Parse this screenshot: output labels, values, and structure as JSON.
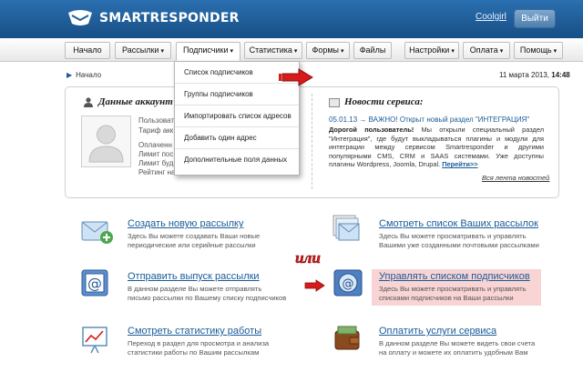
{
  "header": {
    "logo_text": "SMARTRESPONDER",
    "user": "Coolgirl",
    "logout_label": "Выйти",
    "colors": {
      "header_bg": "#1d5e9c",
      "link": "#1a5b97",
      "highlight": "#f9d4d4",
      "arrow": "#d61b1b"
    }
  },
  "nav": {
    "items": [
      {
        "label": "Начало"
      },
      {
        "label": "Рассылки"
      },
      {
        "label": "Подписчики"
      },
      {
        "label": "Статистика"
      },
      {
        "label": "Формы"
      },
      {
        "label": "Файлы"
      },
      {
        "label": "Настройки"
      },
      {
        "label": "Оплата"
      },
      {
        "label": "Помощь"
      }
    ],
    "caret": "▾"
  },
  "dropdown": {
    "items": [
      {
        "label": "Список подписчиков"
      },
      {
        "label": "Группы подписчиков"
      },
      {
        "label": "Импортировать список адресов"
      },
      {
        "label": "Добавить один адрес"
      },
      {
        "label": "Дополнительные поля данных"
      }
    ]
  },
  "breadcrumb": {
    "arrow": "▶",
    "label": "Начало"
  },
  "datetime": {
    "date": "11 марта 2013,",
    "time": "14:48"
  },
  "account": {
    "title": "Данные аккаунт",
    "lines": [
      "Пользоват",
      "Тариф акк",
      "Оплаченн",
      "Лимит пос",
      "Лимит буд",
      "Рейтинг на"
    ]
  },
  "news": {
    "title": "Новости сервиса:",
    "date": "05.01.13",
    "arrow": "→",
    "headline": "ВАЖНО! Открыт новый раздел \"ИНТЕГРАЦИЯ\"",
    "greeting": "Дорогой пользователь!",
    "body": "Мы открыли специальный раздел \"Интеграция\", где будут выкладываться плагины и модули для интеграции между сервисом Smartresponder и другими популярными CMS, CRM и SAAS системами. Уже доступны плагины Wordpress, Joomla, Drupal.",
    "more": "Перейти>>",
    "all_link": "Вся лента новостей"
  },
  "actions": [
    {
      "title": "Создать новую рассылку",
      "desc1": "Здесь Вы можете создавать Ваши новые",
      "desc2": "периодические или серийные рассылки"
    },
    {
      "title": "Смотреть список Ваших рассылок",
      "desc1": "Здесь Вы можете просматривать и управлять",
      "desc2": "Вашими уже созданными почтовыми рассылками"
    },
    {
      "title": "Отправить выпуск рассылки",
      "desc1": "В данном разделе Вы можете отправлять",
      "desc2": "письмо рассылки по Вашему списку подписчиков"
    },
    {
      "title": "Управлять списком подписчиков",
      "desc1": "Здесь Вы можете просматривать и управлять",
      "desc2": "списками подписчиков на Ваши рассылки"
    },
    {
      "title": "Смотреть статистику работы",
      "desc1": "Переход в раздел для просмотра и анализа",
      "desc2": "статистики работы по Вашим рассылкам"
    },
    {
      "title": "Оплатить услуги сервиса",
      "desc1": "В данном разделе Вы можете видеть свои счета",
      "desc2": "на оплату и можете их оплатить удобным Вам"
    }
  ],
  "annotation": {
    "text": "или"
  }
}
